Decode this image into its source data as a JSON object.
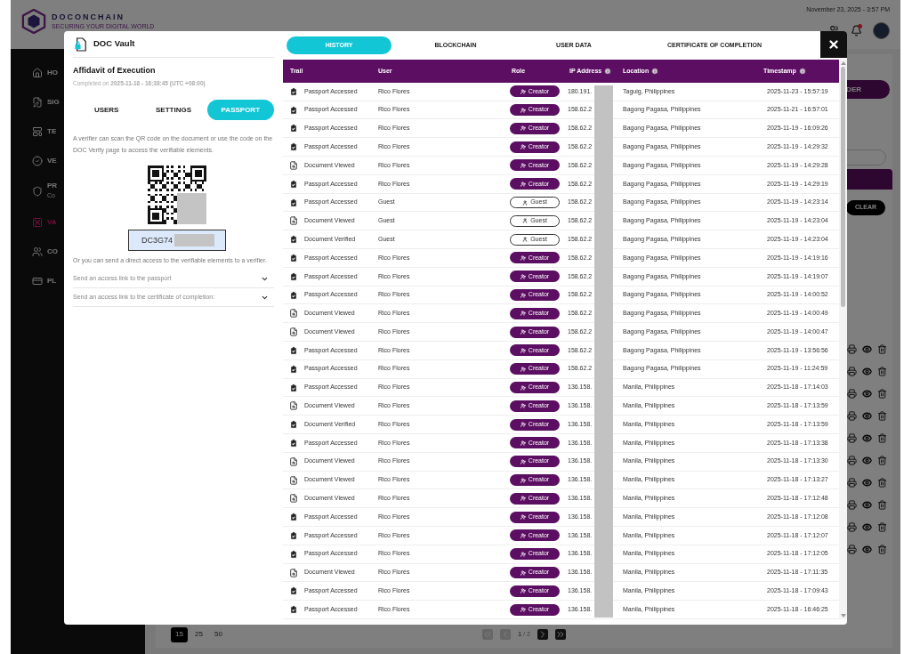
{
  "topbar": {
    "logo": "DOCONCHAIN",
    "tagline": "SECURING YOUR DIGITAL WORLD",
    "date_time": "November 23, 2025 - 3:57 PM",
    "notification_dot": true
  },
  "sidebar": {
    "items": [
      {
        "label": "HO",
        "selected": false
      },
      {
        "label": "SIG",
        "selected": false
      },
      {
        "label": "TE",
        "selected": false
      },
      {
        "label": "VE",
        "selected": false
      },
      {
        "label": "PR",
        "sublabel": "Co",
        "selected": false
      },
      {
        "label": "VA",
        "selected": true
      },
      {
        "label": "CO",
        "selected": false
      },
      {
        "label": "PL",
        "selected": false
      }
    ]
  },
  "background": {
    "create_button": "DER",
    "clear_button": "CLEAR",
    "page_sizes": [
      {
        "label": "15",
        "selected": true
      },
      {
        "label": "25",
        "selected": false
      },
      {
        "label": "50",
        "selected": false
      }
    ],
    "pager": "**1** / 2"
  },
  "modal": {
    "title": "DOC Vault",
    "document_title": "Affidavit of Execution",
    "completed": "Completed on **2025-11-18 - 16:38:45 (UTC +08:00)**",
    "left_tabs": [
      {
        "label": "USERS",
        "selected": false
      },
      {
        "label": "SETTINGS",
        "selected": false
      },
      {
        "label": "PASSPORT",
        "selected": true
      }
    ],
    "scan_text": "A verifier can scan the QR code on the document or use the code on the DOC Verify page to access the verifiable elements.",
    "code": "DC3G74",
    "direct_text": "Or you can send a direct access to the verifiable elements to a verifier.",
    "access_links": [
      {
        "label": "Send an access link to the passport",
        "expanded": false
      },
      {
        "label": "Send an access link to the certificate of completion:",
        "expanded": false
      }
    ],
    "tabs": [
      {
        "label": "HISTORY",
        "selected": true
      },
      {
        "label": "BLOCKCHAIN",
        "selected": false
      },
      {
        "label": "USER DATA",
        "selected": false
      },
      {
        "label": "CERTIFICATE OF COMPLETION",
        "selected": false
      }
    ],
    "table": {
      "columns": [
        {
          "label": "Trail",
          "info": false
        },
        {
          "label": "User",
          "info": false
        },
        {
          "label": "Role",
          "info": false
        },
        {
          "label": "IP Address",
          "info": true
        },
        {
          "label": "Location",
          "info": true
        },
        {
          "label": "Timestamp",
          "info": true
        }
      ],
      "rows": [
        {
          "kind": "passport",
          "trail": "Passport Accessed",
          "user": "Rico Flores",
          "role": {
            "kind": "creator",
            "label": "Creator"
          },
          "ip": "180.191.",
          "location": "Taguig, Philippines",
          "timestamp": "2025-11-23 - 15:57:19"
        },
        {
          "kind": "passport",
          "trail": "Passport Accessed",
          "user": "Rico Flores",
          "role": {
            "kind": "creator",
            "label": "Creator"
          },
          "ip": "158.62.2",
          "location": "Bagong Pagasa, Philippines",
          "timestamp": "2025-11-21 - 16:57:01"
        },
        {
          "kind": "passport",
          "trail": "Passport Accessed",
          "user": "Rico Flores",
          "role": {
            "kind": "creator",
            "label": "Creator"
          },
          "ip": "158.62.2",
          "location": "Bagong Pagasa, Philippines",
          "timestamp": "2025-11-19 - 16:09:26"
        },
        {
          "kind": "passport",
          "trail": "Passport Accessed",
          "user": "Rico Flores",
          "role": {
            "kind": "creator",
            "label": "Creator"
          },
          "ip": "158.62.2",
          "location": "Bagong Pagasa, Philippines",
          "timestamp": "2025-11-19 - 14:29:32"
        },
        {
          "kind": "document",
          "trail": "Document Viewed",
          "user": "Rico Flores",
          "role": {
            "kind": "creator",
            "label": "Creator"
          },
          "ip": "158.62.2",
          "location": "Bagong Pagasa, Philippines",
          "timestamp": "2025-11-19 - 14:29:28"
        },
        {
          "kind": "passport",
          "trail": "Passport Accessed",
          "user": "Rico Flores",
          "role": {
            "kind": "creator",
            "label": "Creator"
          },
          "ip": "158.62.2",
          "location": "Bagong Pagasa, Philippines",
          "timestamp": "2025-11-19 - 14:29:19"
        },
        {
          "kind": "passport",
          "trail": "Passport Accessed",
          "user": "Guest",
          "role": {
            "kind": "guest",
            "label": "Guest"
          },
          "ip": "158.62.2",
          "location": "Bagong Pagasa, Philippines",
          "timestamp": "2025-11-19 - 14:23:14"
        },
        {
          "kind": "document",
          "trail": "Document Viewed",
          "user": "Guest",
          "role": {
            "kind": "guest",
            "label": "Guest"
          },
          "ip": "158.62.2",
          "location": "Bagong Pagasa, Philippines",
          "timestamp": "2025-11-19 - 14:23:04"
        },
        {
          "kind": "passport",
          "trail": "Document Verified",
          "user": "Guest",
          "role": {
            "kind": "guest",
            "label": "Guest"
          },
          "ip": "158.62.2",
          "location": "Bagong Pagasa, Philippines",
          "timestamp": "2025-11-19 - 14:23:04"
        },
        {
          "kind": "passport",
          "trail": "Passport Accessed",
          "user": "Rico Flores",
          "role": {
            "kind": "creator",
            "label": "Creator"
          },
          "ip": "158.62.2",
          "location": "Bagong Pagasa, Philippines",
          "timestamp": "2025-11-19 - 14:19:16"
        },
        {
          "kind": "passport",
          "trail": "Passport Accessed",
          "user": "Rico Flores",
          "role": {
            "kind": "creator",
            "label": "Creator"
          },
          "ip": "158.62.2",
          "location": "Bagong Pagasa, Philippines",
          "timestamp": "2025-11-19 - 14:19:07"
        },
        {
          "kind": "passport",
          "trail": "Passport Accessed",
          "user": "Rico Flores",
          "role": {
            "kind": "creator",
            "label": "Creator"
          },
          "ip": "158.62.2",
          "location": "Bagong Pagasa, Philippines",
          "timestamp": "2025-11-19 - 14:00:52"
        },
        {
          "kind": "document",
          "trail": "Document Viewed",
          "user": "Rico Flores",
          "role": {
            "kind": "creator",
            "label": "Creator"
          },
          "ip": "158.62.2",
          "location": "Bagong Pagasa, Philippines",
          "timestamp": "2025-11-19 - 14:00:49"
        },
        {
          "kind": "document",
          "trail": "Document Viewed",
          "user": "Rico Flores",
          "role": {
            "kind": "creator",
            "label": "Creator"
          },
          "ip": "158.62.2",
          "location": "Bagong Pagasa, Philippines",
          "timestamp": "2025-11-19 - 14:00:47"
        },
        {
          "kind": "passport",
          "trail": "Passport Accessed",
          "user": "Rico Flores",
          "role": {
            "kind": "creator",
            "label": "Creator"
          },
          "ip": "158.62.2",
          "location": "Bagong Pagasa, Philippines",
          "timestamp": "2025-11-19 - 13:56:56"
        },
        {
          "kind": "passport",
          "trail": "Passport Accessed",
          "user": "Rico Flores",
          "role": {
            "kind": "creator",
            "label": "Creator"
          },
          "ip": "158.62.2",
          "location": "Bagong Pagasa, Philippines",
          "timestamp": "2025-11-19 - 11:24:59"
        },
        {
          "kind": "passport",
          "trail": "Passport Accessed",
          "user": "Rico Flores",
          "role": {
            "kind": "creator",
            "label": "Creator"
          },
          "ip": "136.158.",
          "location": "Manila, Philippines",
          "timestamp": "2025-11-18 - 17:14:03"
        },
        {
          "kind": "document",
          "trail": "Document Viewed",
          "user": "Rico Flores",
          "role": {
            "kind": "creator",
            "label": "Creator"
          },
          "ip": "136.158.",
          "location": "Manila, Philippines",
          "timestamp": "2025-11-18 - 17:13:59"
        },
        {
          "kind": "passport",
          "trail": "Document Verified",
          "user": "Rico Flores",
          "role": {
            "kind": "creator",
            "label": "Creator"
          },
          "ip": "136.158.",
          "location": "Manila, Philippines",
          "timestamp": "2025-11-18 - 17:13:59"
        },
        {
          "kind": "passport",
          "trail": "Passport Accessed",
          "user": "Rico Flores",
          "role": {
            "kind": "creator",
            "label": "Creator"
          },
          "ip": "136.158.",
          "location": "Manila, Philippines",
          "timestamp": "2025-11-18 - 17:13:38"
        },
        {
          "kind": "document",
          "trail": "Document Viewed",
          "user": "Rico Flores",
          "role": {
            "kind": "creator",
            "label": "Creator"
          },
          "ip": "136.158.",
          "location": "Manila, Philippines",
          "timestamp": "2025-11-18 - 17:13:30"
        },
        {
          "kind": "document",
          "trail": "Document Viewed",
          "user": "Rico Flores",
          "role": {
            "kind": "creator",
            "label": "Creator"
          },
          "ip": "136.158.",
          "location": "Manila, Philippines",
          "timestamp": "2025-11-18 - 17:13:27"
        },
        {
          "kind": "document",
          "trail": "Document Viewed",
          "user": "Rico Flores",
          "role": {
            "kind": "creator",
            "label": "Creator"
          },
          "ip": "136.158.",
          "location": "Manila, Philippines",
          "timestamp": "2025-11-18 - 17:12:48"
        },
        {
          "kind": "passport",
          "trail": "Passport Accessed",
          "user": "Rico Flores",
          "role": {
            "kind": "creator",
            "label": "Creator"
          },
          "ip": "136.158.",
          "location": "Manila, Philippines",
          "timestamp": "2025-11-18 - 17:12:08"
        },
        {
          "kind": "passport",
          "trail": "Passport Accessed",
          "user": "Rico Flores",
          "role": {
            "kind": "creator",
            "label": "Creator"
          },
          "ip": "136.158.",
          "location": "Manila, Philippines",
          "timestamp": "2025-11-18 - 17:12:07"
        },
        {
          "kind": "passport",
          "trail": "Passport Accessed",
          "user": "Rico Flores",
          "role": {
            "kind": "creator",
            "label": "Creator"
          },
          "ip": "136.158.",
          "location": "Manila, Philippines",
          "timestamp": "2025-11-18 - 17:12:05"
        },
        {
          "kind": "document",
          "trail": "Document Viewed",
          "user": "Rico Flores",
          "role": {
            "kind": "creator",
            "label": "Creator"
          },
          "ip": "136.158.",
          "location": "Manila, Philippines",
          "timestamp": "2025-11-18 - 17:11:35"
        },
        {
          "kind": "passport",
          "trail": "Passport Accessed",
          "user": "Rico Flores",
          "role": {
            "kind": "creator",
            "label": "Creator"
          },
          "ip": "136.158.",
          "location": "Manila, Philippines",
          "timestamp": "2025-11-18 - 17:09:43"
        },
        {
          "kind": "passport",
          "trail": "Passport Accessed",
          "user": "Rico Flores",
          "role": {
            "kind": "creator",
            "label": "Creator"
          },
          "ip": "136.158.",
          "location": "Manila, Philippines",
          "timestamp": "2025-11-18 - 16:46:25"
        }
      ]
    }
  }
}
